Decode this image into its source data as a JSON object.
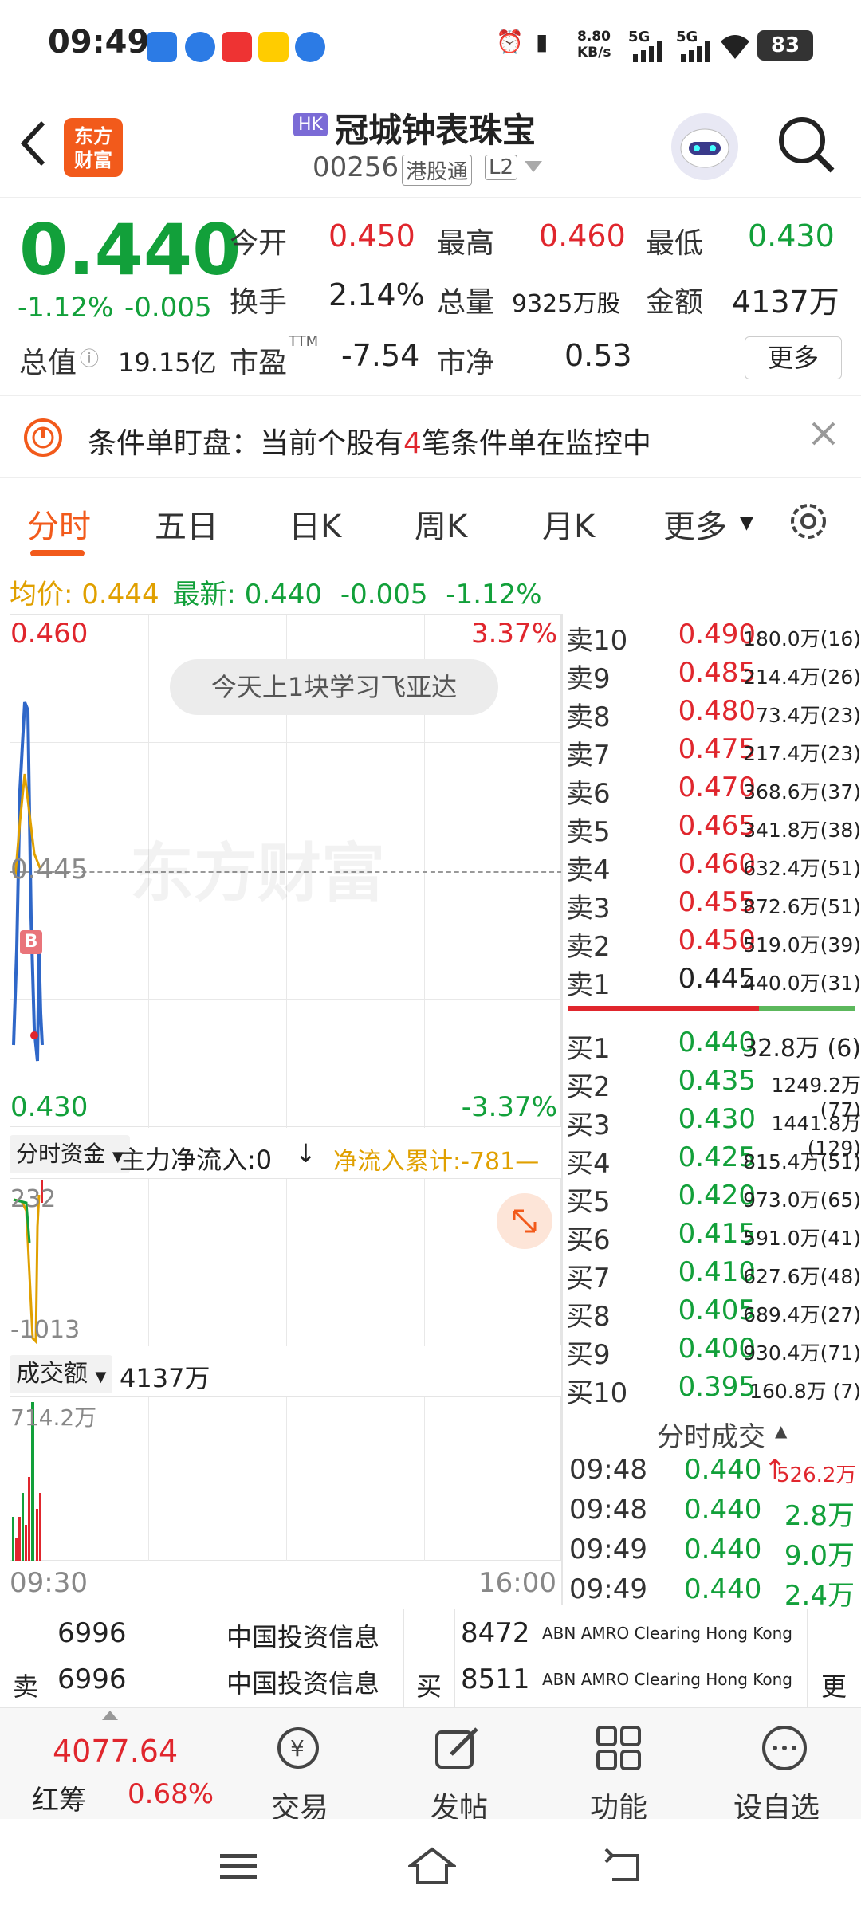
{
  "status_bar": {
    "time": "09:49",
    "speed": "8.80\nKB/s",
    "net1": "5G",
    "net2": "5G",
    "battery": "83"
  },
  "header": {
    "logo_text": "东方\n财富",
    "market_tag": "HK",
    "title": "冠城钟表珠宝",
    "code": "00256",
    "channel_tag": "港股通",
    "level_tag": "L2"
  },
  "quote": {
    "price": "0.440",
    "change_pct": "-1.12%",
    "change": "-0.005",
    "open_label": "今开",
    "open": "0.450",
    "high_label": "最高",
    "high": "0.460",
    "low_label": "最低",
    "low": "0.430",
    "turnover_label": "换手",
    "turnover": "2.14%",
    "volume_label": "总量",
    "volume": "9325万股",
    "amount_label": "金额",
    "amount": "4137万",
    "mcap_label": "总值",
    "mcap": "19.15亿",
    "pe_label": "市盈",
    "pe_sup": "TTM",
    "pe": "-7.54",
    "pb_label": "市净",
    "pb": "0.53",
    "more_button": "更多"
  },
  "notice": {
    "text_pre": "条件单盯盘：当前个股有",
    "count": "4",
    "text_post": "笔条件单在监控中"
  },
  "tabs": [
    "分时",
    "五日",
    "日K",
    "周K",
    "月K",
    "更多"
  ],
  "chart_info": {
    "avg_label": "均价:",
    "avg": "0.444",
    "latest_label": "最新:",
    "latest": "0.440",
    "change": "-0.005",
    "change_pct": "-1.12%",
    "y_top": "0.460",
    "y_mid": "0.445",
    "y_bot": "0.430",
    "pct_top": "3.37%",
    "pct_bot": "-3.37%",
    "banner": "今天上1块学习飞亚达",
    "watermark": "东方财富",
    "b_marker": "B"
  },
  "capital": {
    "selector": "分时资金",
    "main_flow_label": "主力净流入:0",
    "cumulative": "净流入累计:-781—",
    "y_top": "232",
    "y_bot": "-1013"
  },
  "volume_panel": {
    "selector": "成交额",
    "total": "4137万",
    "y_top": "714.2万",
    "x_start": "09:30",
    "x_end": "16:00"
  },
  "order_book": {
    "sells": [
      {
        "label": "卖10",
        "price": "0.490",
        "vol": "180.0万(16)"
      },
      {
        "label": "卖9",
        "price": "0.485",
        "vol": "214.4万(26)"
      },
      {
        "label": "卖8",
        "price": "0.480",
        "vol": "73.4万(23)"
      },
      {
        "label": "卖7",
        "price": "0.475",
        "vol": "217.4万(23)"
      },
      {
        "label": "卖6",
        "price": "0.470",
        "vol": "368.6万(37)"
      },
      {
        "label": "卖5",
        "price": "0.465",
        "vol": "341.8万(38)"
      },
      {
        "label": "卖4",
        "price": "0.460",
        "vol": "632.4万(51)"
      },
      {
        "label": "卖3",
        "price": "0.455",
        "vol": "872.6万(51)"
      },
      {
        "label": "卖2",
        "price": "0.450",
        "vol": "519.0万(39)"
      },
      {
        "label": "卖1",
        "price": "0.445",
        "vol": "440.0万(31)"
      }
    ],
    "buys": [
      {
        "label": "买1",
        "price": "0.440",
        "vol": "32.8万 (6)"
      },
      {
        "label": "买2",
        "price": "0.435",
        "vol": "1249.2万(77)"
      },
      {
        "label": "买3",
        "price": "0.430",
        "vol": "1441.8万(129)"
      },
      {
        "label": "买4",
        "price": "0.425",
        "vol": "815.4万(51)"
      },
      {
        "label": "买5",
        "price": "0.420",
        "vol": "973.0万(65)"
      },
      {
        "label": "买6",
        "price": "0.415",
        "vol": "591.0万(41)"
      },
      {
        "label": "买7",
        "price": "0.410",
        "vol": "627.6万(48)"
      },
      {
        "label": "买8",
        "price": "0.405",
        "vol": "689.4万(27)"
      },
      {
        "label": "买9",
        "price": "0.400",
        "vol": "930.4万(71)"
      },
      {
        "label": "买10",
        "price": "0.395",
        "vol": "160.8万 (7)"
      }
    ]
  },
  "ticks": {
    "title": "分时成交",
    "rows": [
      {
        "time": "09:48",
        "price": "0.440",
        "vol": "526.2万",
        "arrow": "↑"
      },
      {
        "time": "09:48",
        "price": "0.440",
        "vol": "2.8万",
        "arrow": ""
      },
      {
        "time": "09:49",
        "price": "0.440",
        "vol": "9.0万",
        "arrow": ""
      },
      {
        "time": "09:49",
        "price": "0.440",
        "vol": "2.4万",
        "arrow": ""
      }
    ]
  },
  "brokers": {
    "sell_label": "卖",
    "buy_label": "买",
    "more": "更",
    "sell_rows": [
      {
        "id": "6996",
        "name": "中国投资信息"
      },
      {
        "id": "6996",
        "name": "中国投资信息"
      }
    ],
    "buy_rows": [
      {
        "id": "8472",
        "name": "ABN AMRO Clearing Hong Kong"
      },
      {
        "id": "8511",
        "name": "ABN AMRO Clearing Hong Kong"
      }
    ]
  },
  "bottom_nav": {
    "index_value": "4077.64",
    "index_name": "红筹",
    "index_pct": "0.68%",
    "items": [
      "交易",
      "发帖",
      "功能",
      "设自选"
    ]
  },
  "colors": {
    "up": "#e0262d",
    "down": "#12a03a",
    "accent": "#f25a1b",
    "avg": "#e0a000"
  }
}
